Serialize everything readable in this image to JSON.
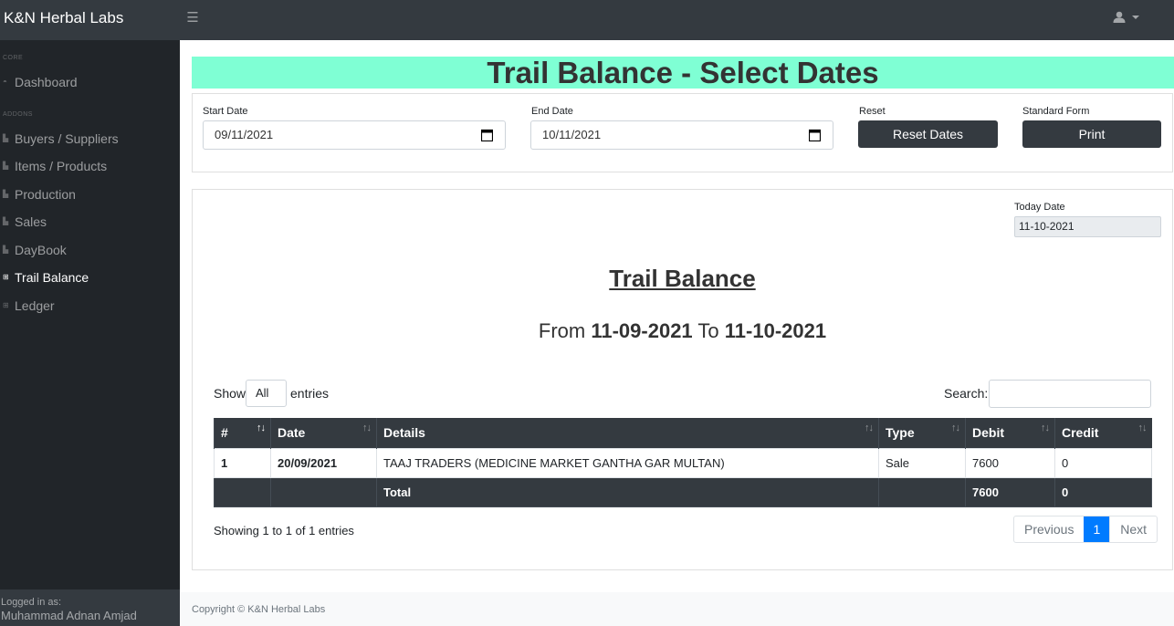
{
  "navbar": {
    "brand": "K&N Herbal Labs",
    "toggle_icon": "☰"
  },
  "sidebar": {
    "core_heading": "CORE",
    "addons_heading": "ADDONS",
    "items": [
      {
        "label": "Dashboard",
        "icon": "tachometer-icon"
      },
      {
        "label": "Buyers / Suppliers",
        "icon": "bar-chart-icon"
      },
      {
        "label": "Items / Products",
        "icon": "bar-chart-icon"
      },
      {
        "label": "Production",
        "icon": "bar-chart-icon"
      },
      {
        "label": "Sales",
        "icon": "bar-chart-icon"
      },
      {
        "label": "DayBook",
        "icon": "bar-chart-icon"
      },
      {
        "label": "Trail Balance",
        "icon": "table-icon",
        "active": true
      },
      {
        "label": "Ledger",
        "icon": "table-icon"
      }
    ],
    "footer": {
      "logged_in_label": "Logged in as:",
      "user": "Muhammad Adnan Amjad"
    }
  },
  "banner": {
    "title": "Trail Balance - Select Dates",
    "color": "#7fffd4"
  },
  "filters": {
    "start_label": "Start Date",
    "start_value": "09/11/2021",
    "end_label": "End Date",
    "end_value": "10/11/2021",
    "reset_label": "Reset",
    "reset_button": "Reset Dates",
    "standard_label": "Standard Form",
    "print_button": "Print"
  },
  "report": {
    "today_label": "Today Date",
    "today_value": "11-10-2021",
    "title": "Trail Balance",
    "from_word": "From",
    "from_date": "11-09-2021",
    "to_word": "To",
    "to_date": "11-10-2021",
    "show_word": "Show",
    "length_value": "All",
    "entries_word": "entries",
    "search_label": "Search:",
    "columns": [
      "#",
      "Date",
      "Details",
      "Type",
      "Debit",
      "Credit"
    ],
    "rows": [
      {
        "num": "1",
        "date": "20/09/2021",
        "details": "TAAJ TRADERS (MEDICINE MARKET GANTHA GAR MULTAN)",
        "type": "Sale",
        "debit": "7600",
        "credit": "0"
      }
    ],
    "total": {
      "label": "Total",
      "debit": "7600",
      "credit": "0"
    },
    "info": "Showing 1 to 1 of 1 entries",
    "pagination": {
      "previous": "Previous",
      "current": "1",
      "next": "Next"
    }
  },
  "footer": {
    "copyright": "Copyright © K&N Herbal Labs"
  },
  "colors": {
    "navbar": "#343a40",
    "sidebar": "#212529",
    "accent": "#007bff"
  }
}
